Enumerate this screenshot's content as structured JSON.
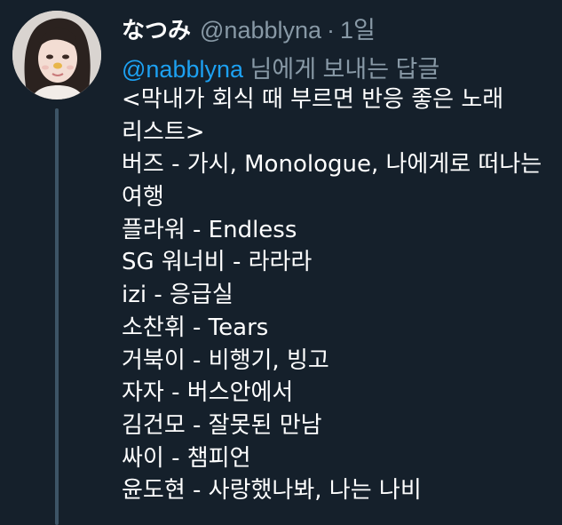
{
  "tweet": {
    "display_name": "なつみ",
    "handle": "@nabblyna",
    "separator": "·",
    "time": "1일",
    "reply_to": {
      "mention": "@nabblyna",
      "suffix": " 님에게 보내는 답글"
    },
    "lines": [
      "<막내가 회식 때 부르면 반응 좋은 노래",
      "리스트>",
      "버즈 - 가시, Monologue, 나에게로 떠나는",
      "여행",
      "플라워 - Endless",
      "SG 워너비 - 라라라",
      "izi - 응급실",
      "소찬휘 - Tears",
      "거북이 - 비행기, 빙고",
      "자자 - 버스안에서",
      "김건모 - 잘못된 만남",
      "싸이 - 챔피언",
      "윤도현 - 사랑했나봐, 나는 나비"
    ]
  },
  "colors": {
    "background": "#15202b",
    "text": "#ffffff",
    "secondary": "#8899a6",
    "accent": "#1da1f2",
    "thread_line": "#3d5466"
  }
}
